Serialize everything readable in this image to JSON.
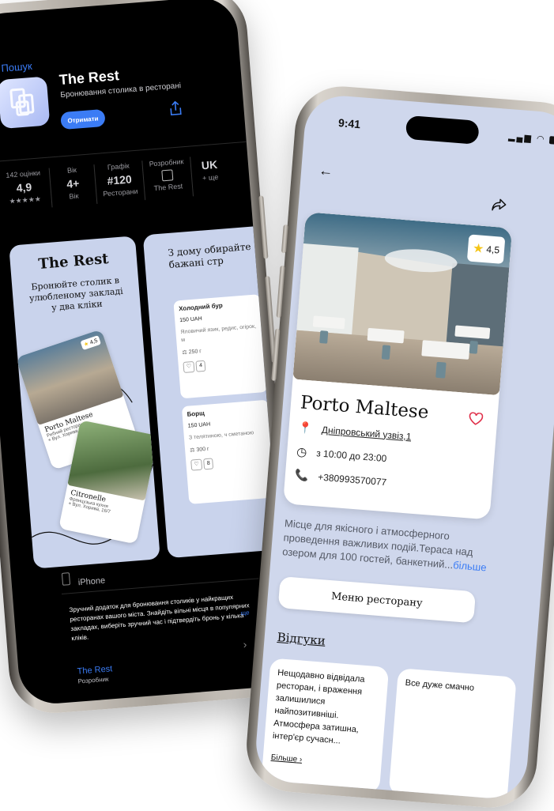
{
  "left_app_store": {
    "back_label": "Пошук",
    "app_name": "The Rest",
    "app_subtitle": "Бронювання столика в ресторані",
    "get_button": "Отримати",
    "stats": [
      {
        "label": "142 оцінки",
        "value": "4,9",
        "sub": "★★★★★"
      },
      {
        "label": "Вік",
        "value": "4+",
        "sub": "Вік"
      },
      {
        "label": "Графік",
        "value": "#120",
        "sub": "Ресторани"
      },
      {
        "label": "Розробник",
        "value": "",
        "sub": "The Rest"
      },
      {
        "label": "",
        "value": "UK",
        "sub": "+ ще"
      }
    ],
    "screenshot1": {
      "title": "The Rest",
      "tagline": "Бронюйте столик в улюбленому закладі у два кліки",
      "card1": {
        "name": "Porto Maltese",
        "type": "Рибний ресторан",
        "address": "Вул. Хорива, 16/7",
        "rating": "4,5"
      },
      "card2": {
        "name": "Citronelle",
        "type": "Французька кухня",
        "address": "Вул. Хорива, 16/7"
      }
    },
    "screenshot2": {
      "heading": "З дому обирайте бажані стр",
      "item1": {
        "name": "Холодний бур",
        "price": "150 UAH",
        "desc": "Яловичий язик, редис, огірок, м",
        "weight": "250 г",
        "qty": "4"
      },
      "item2": {
        "name": "Борщ",
        "price": "150 UAH",
        "desc": "З телятиною, ч сметаною",
        "weight": "300 г",
        "qty": "8"
      }
    },
    "device_label": "iPhone",
    "description": "Зручний додаток для бронювання столиків у найкращих ресторанах вашого міста. Знайдіть вільні місця в популярних закладах, виберіть зручний час і підтвердіть бронь у кілька кліків.",
    "more_label": "ще",
    "developer_name": "The Rest",
    "developer_label": "Розробник"
  },
  "right_app": {
    "status_time": "9:41",
    "rating": "4,5",
    "restaurant_name": "Porto Maltese",
    "address": "Дніпровський узвіз,1",
    "hours": "з 10:00 до 23:00",
    "phone": "+380993570077",
    "about_text": "Місце для якісного і атмосферного проведення важливих подій.Тераса над озером для 100 гостей, банкетний...",
    "about_more": "більше",
    "menu_button": "Меню ресторану",
    "reviews_title": "Відгуки",
    "reviews": [
      {
        "text": "Нещодавно відвідала ресторан, і враження залишилися найпозитивніші. Атмосфера затишна, інтер'єр сучасн...",
        "more": "Більше"
      },
      {
        "text": "Все дуже смачно"
      }
    ],
    "colors": {
      "accent": "#3b7cf5",
      "heart": "#e0304a",
      "star": "#f5c518",
      "background": "#cfd7ec"
    }
  }
}
